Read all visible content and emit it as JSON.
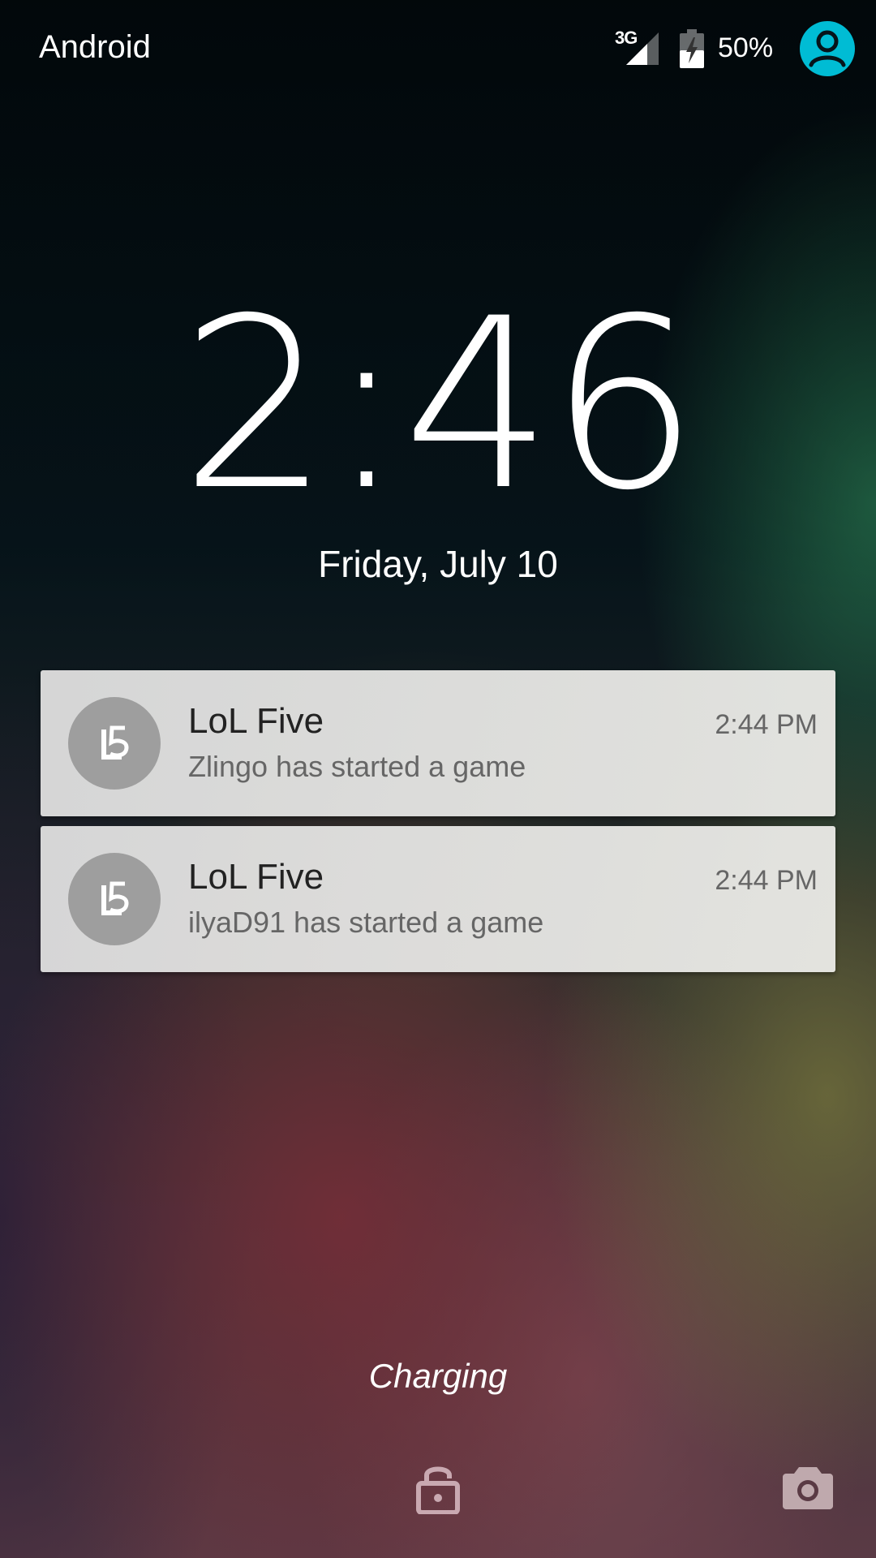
{
  "status_bar": {
    "carrier": "Android",
    "network_type": "3G",
    "battery_percent": "50%",
    "signal_icon": "cellular-signal-icon",
    "battery_icon": "battery-charging-icon",
    "user_icon": "user-avatar-icon",
    "accent": "#00bcd4"
  },
  "clock": {
    "time": "2:46",
    "date": "Friday, July 10"
  },
  "notifications": [
    {
      "app": "LoL Five",
      "text": "Zlingo has started a game",
      "time": "2:44 PM",
      "icon_label": "L5"
    },
    {
      "app": "LoL Five",
      "text": "ilyaD91 has started a game",
      "time": "2:44 PM",
      "icon_label": "L5"
    }
  ],
  "footer": {
    "status": "Charging",
    "lock_icon": "lock-icon",
    "camera_icon": "camera-icon"
  }
}
